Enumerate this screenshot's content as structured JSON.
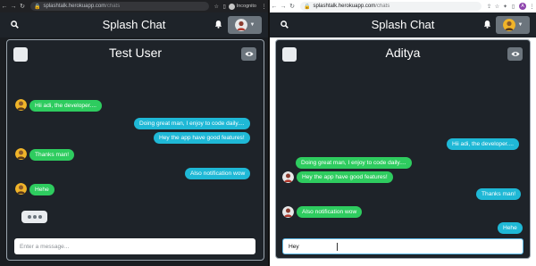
{
  "left": {
    "browser": {
      "url_host": "splashtalk.herokuapp.com",
      "url_path": "/chats",
      "incognito_label": "Incognito"
    },
    "navbar": {
      "title": "Splash Chat"
    },
    "chat": {
      "name": "Test User",
      "input_placeholder": "Enter a message...",
      "messages": [
        {
          "text": "Hii adi, the developer....",
          "side": "received"
        },
        {
          "text": "Doing great man, I enjoy to code daily....",
          "side": "sent"
        },
        {
          "text": "Hey the app have good features!",
          "side": "sent"
        },
        {
          "text": "Thanks man!",
          "side": "received"
        },
        {
          "text": "Also notification wow",
          "side": "sent"
        },
        {
          "text": "Hehe",
          "side": "received"
        }
      ]
    }
  },
  "right": {
    "browser": {
      "url_host": "splashtalk.herokuapp.com",
      "url_path": "/chats",
      "profile_initial": "A"
    },
    "navbar": {
      "title": "Splash Chat"
    },
    "chat": {
      "name": "Aditya",
      "input_value": "Hey",
      "messages": [
        {
          "text": "Hii adi, the developer....",
          "side": "sent"
        },
        {
          "text": "Doing great man, I enjoy to code daily....",
          "side": "received"
        },
        {
          "text": "Hey the app have good features!",
          "side": "received"
        },
        {
          "text": "Thanks man!",
          "side": "sent"
        },
        {
          "text": "Also notification wow",
          "side": "received"
        },
        {
          "text": "Hehe",
          "side": "sent"
        }
      ]
    }
  },
  "colors": {
    "sent_bubble_left": "#2ecc5f",
    "received_bubble": "#1fb8d6",
    "panel_bg": "#1e2329",
    "navbar_bg": "#1e2329"
  },
  "icons": [
    "search-icon",
    "bell-icon",
    "eye-icon",
    "chevron-down-icon",
    "lock-icon",
    "back-icon",
    "forward-icon",
    "reload-icon"
  ]
}
